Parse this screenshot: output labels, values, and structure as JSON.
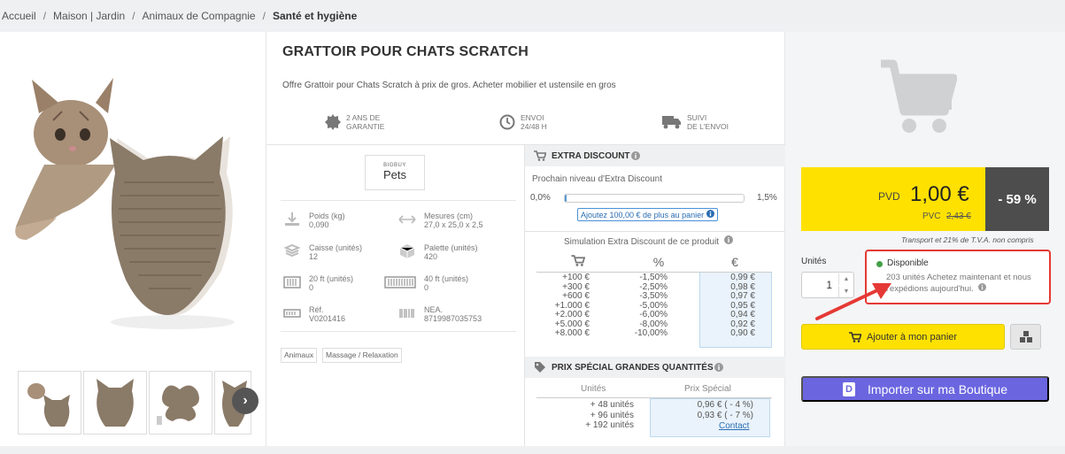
{
  "breadcrumb": {
    "items": [
      "Accueil",
      "Maison | Jardin",
      "Animaux de Compagnie"
    ],
    "current": "Santé et hygiène",
    "separator": "/"
  },
  "product": {
    "title": "GRATTOIR POUR CHATS SCRATCH",
    "description": "Offre Grattoir pour Chats Scratch à prix de gros. Acheter mobilier et ustensile en gros",
    "guarantees": [
      {
        "icon": "seal-icon",
        "line1": "2 ANS DE",
        "line2": "GARANTIE"
      },
      {
        "icon": "clock-icon",
        "line1": "ENVOI",
        "line2": "24/48 H"
      },
      {
        "icon": "truck-icon",
        "line1": "SUIVI",
        "line2": "DE L'ENVOI"
      }
    ],
    "brand": {
      "top": "BIGBUY",
      "name": "Pets"
    },
    "specs": [
      {
        "icon": "weight-icon",
        "label": "Poids (kg)",
        "value": "0,090"
      },
      {
        "icon": "dimensions-icon",
        "label": "Mesures (cm)",
        "value": "27,0 x 25,0 x 2,5"
      },
      {
        "icon": "box-icon",
        "label": "Caisse (unités)",
        "value": "12"
      },
      {
        "icon": "pallet-icon",
        "label": "Palette (unités)",
        "value": "420"
      },
      {
        "icon": "container-20-icon",
        "label": "20 ft (unités)",
        "value": "0"
      },
      {
        "icon": "container-40-icon",
        "label": "40 ft (unités)",
        "value": "0"
      },
      {
        "icon": "reference-icon",
        "label": "Réf.",
        "value": "V0201416"
      },
      {
        "icon": "barcode-icon",
        "label": "NEA.",
        "value": "8719987035753"
      }
    ],
    "tags": [
      "Animaux",
      "Massage / Relaxation"
    ]
  },
  "extra_discount": {
    "title": "EXTRA DISCOUNT",
    "next_level_label": "Prochain niveau d'Extra Discount",
    "progress_start": "0,0%",
    "progress_end": "1,5%",
    "progress_fraction": 0.01,
    "tip": "Ajoutez 100,00 € de plus au panier",
    "simulation_title": "Simulation Extra Discount de ce produit",
    "headers": {
      "percent": "%",
      "euro": "€"
    },
    "rows": [
      {
        "amount": "+100 €",
        "percent": "-1,50%",
        "price": "0,99 €"
      },
      {
        "amount": "+300 €",
        "percent": "-2,50%",
        "price": "0,98 €"
      },
      {
        "amount": "+600 €",
        "percent": "-3,50%",
        "price": "0,97 €"
      },
      {
        "amount": "+1.000 €",
        "percent": "-5,00%",
        "price": "0,95 €"
      },
      {
        "amount": "+2.000 €",
        "percent": "-6,00%",
        "price": "0,94 €"
      },
      {
        "amount": "+5.000 €",
        "percent": "-8,00%",
        "price": "0,92 €"
      },
      {
        "amount": "+8.000 €",
        "percent": "-10,00%",
        "price": "0,90 €"
      }
    ]
  },
  "special_price": {
    "title": "PRIX SPÉCIAL GRANDES QUANTITÉS",
    "units_header": "Unités",
    "price_header": "Prix Spécial",
    "rows": [
      {
        "units": "+ 48 unités",
        "price": "0,96 € ( - 4 %)"
      },
      {
        "units": "+ 96 unités",
        "price": "0,93 € ( - 7 %)"
      },
      {
        "units": "+ 192 unités",
        "price": ""
      }
    ],
    "contact_label": "Contact"
  },
  "buybox": {
    "pvd_label": "PVD",
    "pvd_value": "1,00 €",
    "pvc_label": "PVC",
    "pvc_value": "2,43 €",
    "discount": "- 59 %",
    "tax_note": "Transport et 21% de T.V.A. non compris",
    "units_label": "Unités",
    "quantity": "1",
    "stock_status": "Disponible",
    "stock_detail": "203 unités Achetez maintenant et nous l'expédions aujourd'hui.",
    "add_to_cart": "Ajouter à mon panier",
    "import_label": "Importer sur ma Boutique",
    "colors": {
      "accent_yellow": "#ffe100",
      "import_purple": "#6b66e0",
      "alert_red": "#e53935",
      "available_green": "#43a047"
    }
  }
}
